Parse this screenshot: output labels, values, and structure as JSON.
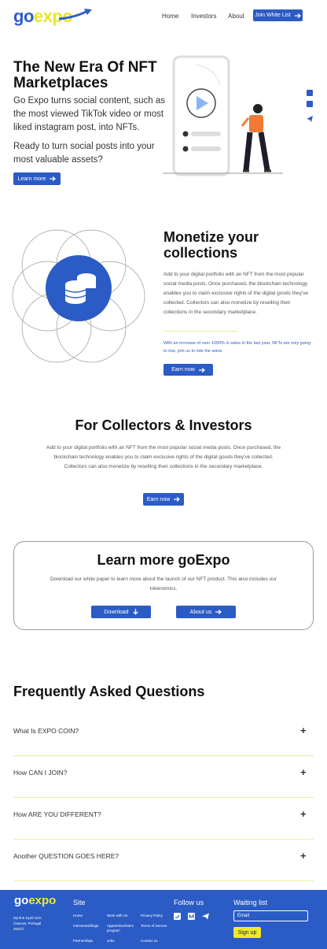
{
  "header": {
    "logo_go": "go",
    "logo_expo": "expo",
    "nav": [
      "Home",
      "Investors",
      "About"
    ],
    "cta": "Join White List"
  },
  "hero": {
    "title": "The New Era Of NFT Marketplaces",
    "para1": "Go Expo turns social content, such as the most viewed TikTok video or most liked instagram post, into NFTs.",
    "para2": "Ready to turn social posts into your most valuable assets?",
    "button": "Learn more",
    "side_icons": [
      "discord-icon",
      "medium-icon",
      "telegram-icon"
    ]
  },
  "monetize": {
    "title": "Monetize your collections",
    "body": "Add to your digital portfolio with an NFT from the most popular social media posts. Once purchased, the blockchain technology enables you to claim exclusive rights of the digital goods they've collected. Collectors can also monetize by reselling their collections in the secondary marketplace.",
    "note": "With an increase of over 1000% in sales in the last year, NFTs are only going to rise, join us to ride the wave.",
    "button": "Earn now"
  },
  "collectors": {
    "title": "For Collectors & Investors",
    "body": "Add to your digital portfolio with an NFT from the most popular social media posts. Once purchased, the blockchain technology enables you to claim exclusive rights of the digital goods they've collected. Collectors can also monetize by reselling their collections in the secondary marketplace.",
    "button": "Earn now"
  },
  "learn": {
    "title": "Learn more goExpo",
    "body": "Download our white paper to learn more about the launch of our NFT product. This also includes our tokenomics.",
    "download": "Download",
    "about": "About us"
  },
  "faq": {
    "title": "Frequently Asked Questions",
    "items": [
      "What Is EXPO COIN?",
      "How CAN I JOIN?",
      "How ARE YOU DIFFERENT?",
      "Another QUESTION GOES HERE?"
    ]
  },
  "footer": {
    "logo_go": "go",
    "logo_expo": "expo",
    "address": "Syntl & Syntl LDA, Cascais, Portugal 2021©",
    "site_title": "Site",
    "links": [
      "Home",
      "Work with Us",
      "Privacy Policy",
      "Interviews/blogs",
      "Apprentice/Intern program",
      "Terms of Service",
      "Partnerships",
      "Jobs",
      "Contact us"
    ],
    "follow_title": "Follow us",
    "waiting_title": "Waiting list",
    "email_placeholder": "Email",
    "signup": "Sign up"
  },
  "colors": {
    "brand_blue": "#2b5bc4",
    "brand_yellow": "#eeea2b"
  }
}
